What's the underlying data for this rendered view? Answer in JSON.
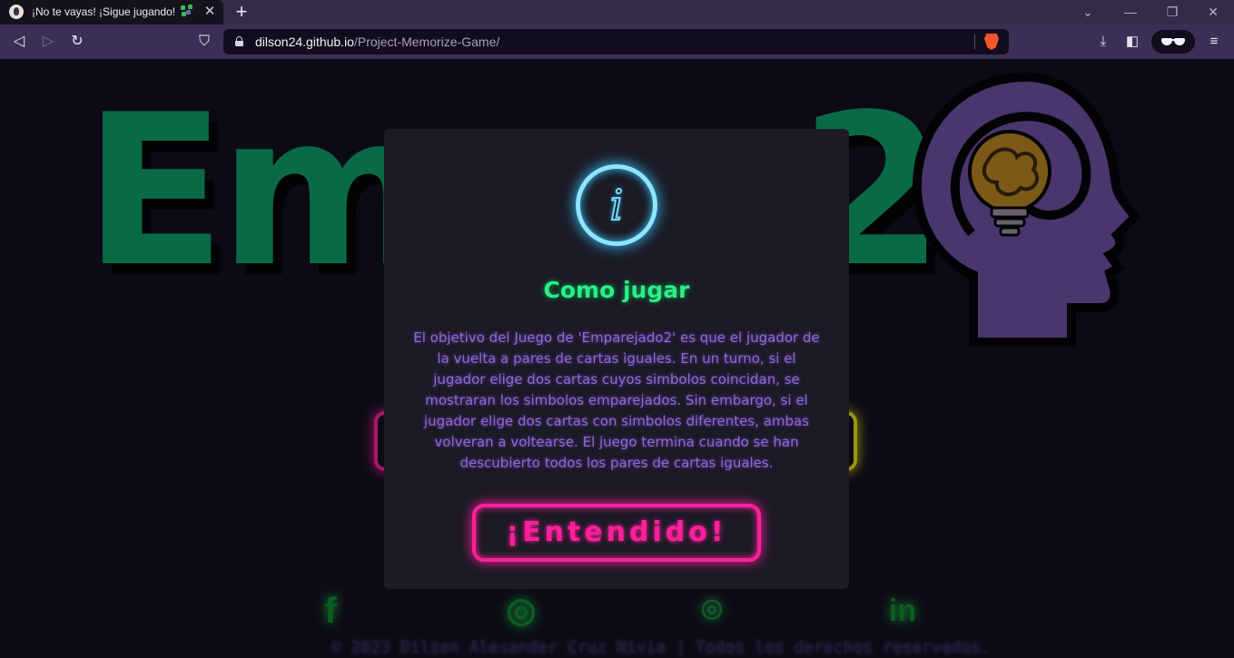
{
  "browser": {
    "tab": {
      "title": "¡No te vayas! ¡Sigue jugando!",
      "emoji_icon": "puzzle-piece-icon",
      "close_label": "✕"
    },
    "new_tab_label": "+",
    "window_controls": {
      "tabs_menu": "⌄",
      "minimize": "—",
      "restore": "❐",
      "close": "✕"
    },
    "nav": {
      "back": "◁",
      "forward": "▷",
      "reload": "↻",
      "bookmark": "⛉"
    },
    "url": {
      "host": "dilson24.github.io",
      "path": "/Project-Memorize-Game/"
    },
    "toolbar_icons": {
      "download": "⤓",
      "sidebar": "◧",
      "menu": "≡"
    },
    "colors": {
      "tabbar": "#352b47",
      "toolbar": "#3c2f55",
      "omnibox": "#110d1d"
    }
  },
  "page": {
    "logo_text": "Emp",
    "logo_tail": "2",
    "social": {
      "facebook": "f",
      "instagram": "◎",
      "github": "⌾",
      "linkedin": "in"
    },
    "copyright": "© 2023 Dilson Alexander Cruz Nivia | Todos los derechos reservados.",
    "colors": {
      "background": "#0f0d17",
      "logo_green": "#0aa062",
      "head_purple": "#6e4f9e",
      "bulb_gold": "#b9861c"
    }
  },
  "modal": {
    "icon": "info-icon",
    "info_glyph": "i",
    "title": "Como jugar",
    "body": "El objetivo del Juego de 'Emparejado2' es que el jugador de la vuelta a pares de cartas iguales. En un turno, si el jugador elige dos cartas cuyos simbolos coincidan, se mostraran los simbolos emparejados. Sin embargo, si el jugador elige dos cartas con simbolos diferentes, ambas volveran a voltearse. El juego termina cuando se han descubierto todos los pares de cartas iguales.",
    "confirm_button": "¡Entendido!",
    "colors": {
      "title": "#2aef85",
      "text": "#8f6ad0",
      "button": "#ff1f9b",
      "icon": "#8fe4ff",
      "panel": "#1b1a25"
    }
  }
}
